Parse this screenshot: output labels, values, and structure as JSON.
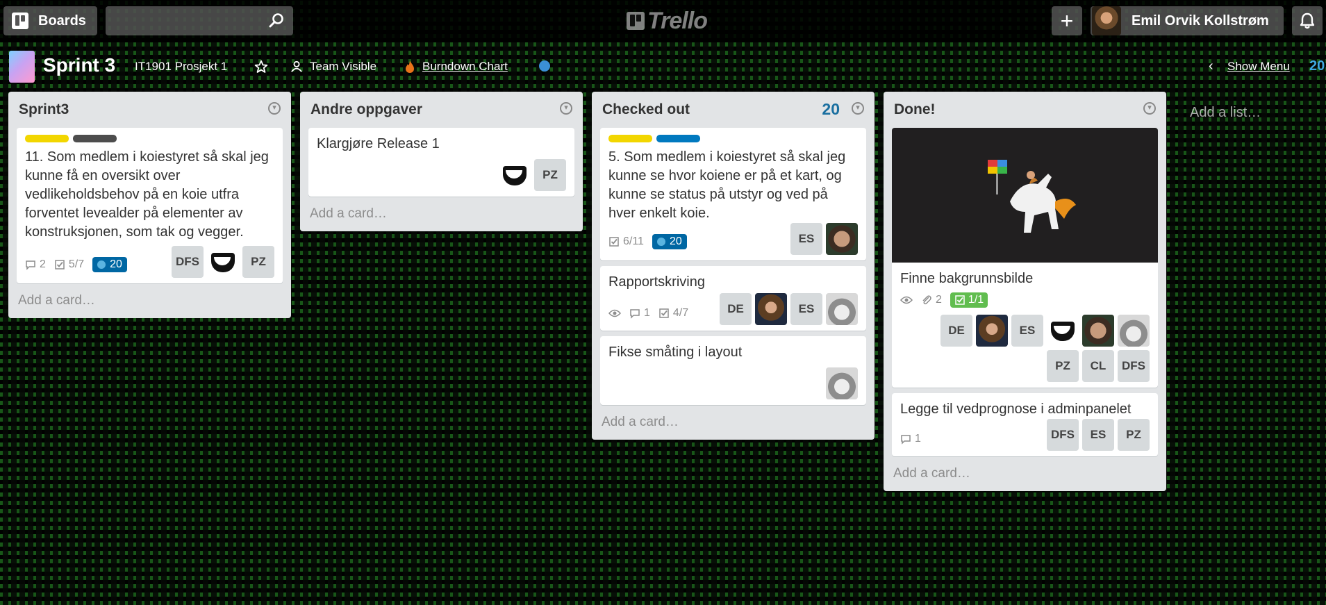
{
  "header": {
    "boards_label": "Boards",
    "search_placeholder": "",
    "logo_text": "Trello",
    "add_label": "+",
    "user_name": "Emil Orvik Kollstrøm"
  },
  "board": {
    "title": "Sprint 3",
    "team": "IT1901 Prosjekt 1",
    "visibility": "Team Visible",
    "burndown": "Burndown Chart",
    "show_menu": "Show Menu",
    "edge_number": "20",
    "add_list": "Add a list…"
  },
  "colors": {
    "label_yellow": "#f2d600",
    "label_dark": "#4d4d4d",
    "label_blue": "#0079bf",
    "badge_blue": "#0067a3",
    "badge_green": "#61bd4f",
    "count_blue": "#1a6fa0"
  },
  "lists": [
    {
      "title": "Sprint3",
      "count": "",
      "add_card": "Add a card…",
      "cards": [
        {
          "title": "11. Som medlem i koiestyret så skal jeg kunne få en oversikt over vedlikeholdsbehov på en koie utfra forventet levealder på elementer av konstruksjonen, som tak og vegger.",
          "comments": "2",
          "checklist": "5/7",
          "points": "20",
          "members": [
            "DFS",
            "",
            "PZ"
          ]
        }
      ]
    },
    {
      "title": "Andre oppgaver",
      "count": "",
      "add_card": "Add a card…",
      "cards": [
        {
          "title": "Klargjøre Release 1",
          "members": [
            "",
            "PZ"
          ]
        }
      ]
    },
    {
      "title": "Checked out",
      "count": "20",
      "add_card": "Add a card…",
      "cards": [
        {
          "title": "5. Som medlem i koiestyret så skal jeg kunne se hvor koiene er på et kart, og kunne se status på utstyr og ved på hver enkelt koie.",
          "checklist": "6/11",
          "points": "20",
          "members": [
            "ES",
            ""
          ]
        },
        {
          "title": "Rapportskriving",
          "comments": "1",
          "checklist": "4/7",
          "members": [
            "DE",
            "",
            "ES",
            ""
          ]
        },
        {
          "title": "Fikse småting i layout",
          "members": [
            ""
          ]
        }
      ]
    },
    {
      "title": "Done!",
      "count": "",
      "add_card": "Add a card…",
      "cards": [
        {
          "title": "Finne bakgrunnsbilde",
          "attachments": "2",
          "checklist": "1/1",
          "members": [
            "DE",
            "",
            "ES",
            "",
            "",
            "",
            "PZ",
            "CL",
            "DFS"
          ]
        },
        {
          "title": "Legge til vedprognose i adminpanelet",
          "comments": "1",
          "members": [
            "DFS",
            "ES",
            "PZ"
          ]
        }
      ]
    }
  ]
}
